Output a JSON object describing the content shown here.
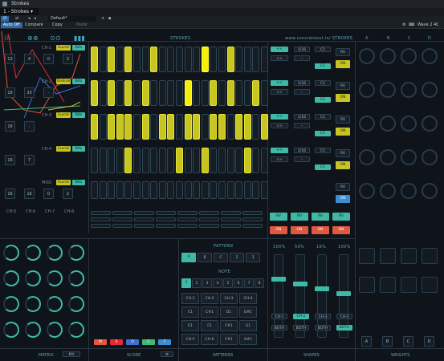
{
  "window": {
    "title": "Strokes"
  },
  "tab": {
    "label": "1 - Strokes"
  },
  "toolbar": {
    "preset": "Default*",
    "auto_off": "Auto Off",
    "compare": "Compare",
    "copy": "Copy",
    "paste": "Paste",
    "right_label": "Wave 2 4C",
    "power": "⏻"
  },
  "sections": {
    "strokes": "STROKES",
    "rate": "www.concreteout.in/ STROKES",
    "matrix": "MATRIX",
    "score": "SCORE",
    "patterns": "PATTERNS",
    "shapes": "SHAPES",
    "weights": "WEIGHTS"
  },
  "weights_cols": [
    "A",
    "B",
    "C",
    "D"
  ],
  "channels": [
    {
      "name": "CH-1",
      "mode": "Euclid",
      "alt": "Bits",
      "vals": [
        "13",
        "4",
        "0",
        "2"
      ],
      "steps": [
        1,
        0,
        1,
        0,
        1,
        0,
        0,
        1,
        0,
        0,
        0,
        0,
        0,
        1,
        0,
        0,
        1,
        0,
        0,
        0,
        0
      ],
      "rate": [
        "<<",
        "1/16",
        "C1",
        ">>",
        "··",
        "C1"
      ],
      "rv": "RV",
      "on": "ON"
    },
    {
      "name": "CH-2",
      "mode": "Ordinal",
      "alt": "Bits",
      "vals": [
        "16",
        "20",
        "·"
      ],
      "steps": [
        1,
        0,
        1,
        0,
        1,
        0,
        1,
        0,
        0,
        0,
        0,
        1,
        0,
        0,
        1,
        0,
        1,
        0,
        0,
        1,
        0
      ],
      "rate": [
        "<<",
        "1/16",
        "C1",
        ">>",
        "··",
        "C1"
      ],
      "rv": "RV",
      "on": "ON"
    },
    {
      "name": "CH-3",
      "mode": "Euclid",
      "alt": "Bits",
      "vals": [
        "16",
        "·"
      ],
      "steps": [
        1,
        0,
        1,
        1,
        1,
        0,
        1,
        0,
        1,
        1,
        0,
        1,
        1,
        0,
        1,
        1,
        0,
        1,
        1,
        0,
        1
      ],
      "rate": [
        "<<",
        "1/16",
        "C1",
        ">>",
        "··",
        "C1"
      ],
      "rv": "RV",
      "on": "ON"
    },
    {
      "name": "CH-4",
      "mode": "Euclid",
      "alt": "Bits",
      "vals": [
        "16",
        "7"
      ],
      "steps": [
        0,
        0,
        0,
        0,
        1,
        0,
        0,
        0,
        0,
        0,
        1,
        0,
        0,
        1,
        0,
        0,
        0,
        0,
        1,
        0,
        0
      ],
      "rate": [
        "<<",
        "1/16",
        "C1",
        ">>",
        "··",
        "C1"
      ],
      "rv": "RV",
      "on": "ON"
    },
    {
      "name": "MOD",
      "mode": "Euclid",
      "alt": "Bits",
      "vals": [
        "16",
        "16",
        "0",
        "2"
      ],
      "steps": [
        0,
        0,
        0,
        0,
        0,
        0,
        0,
        0,
        0,
        0,
        0,
        0,
        0,
        0,
        0,
        0,
        0,
        0,
        0,
        0,
        0
      ],
      "rate": [
        "BR",
        "VTU"
      ],
      "rv": "RV",
      "on": "ON"
    }
  ],
  "ch_row": [
    "CH-5",
    "CH-6",
    "CH-7",
    "CH-8"
  ],
  "rv_row": [
    "RV",
    "RV",
    "RV",
    "RV"
  ],
  "on_row": [
    "ON",
    "ON",
    "ON",
    "ON"
  ],
  "matrix_select": "MX",
  "score": {
    "colors": [
      "#e0583f",
      "#e02a3a",
      "#3a6fd4",
      "#3fb87a",
      "#3a8fd4"
    ],
    "labels": [
      "M",
      "S",
      "O",
      "C",
      "T"
    ]
  },
  "patterns": {
    "title": "PATTERN",
    "tabs": [
      "A",
      "B",
      "C",
      "2",
      "3"
    ],
    "note_title": "NOTE",
    "steps": [
      "1",
      "2",
      "3",
      "4",
      "5",
      "6",
      "7",
      "8"
    ],
    "cells": [
      "CH-1",
      "CH-2",
      "CH-3",
      "CH-4",
      "C1",
      "C#1",
      "D1",
      "D#1",
      "E1",
      "F1",
      "F#1",
      "G1",
      "CH-5",
      "CH-6",
      "F#1",
      "G#1"
    ]
  },
  "shapes": {
    "cols": [
      "100%",
      "50%",
      "16%",
      "100%"
    ],
    "labels": [
      "CH-1",
      "CH-2",
      "CH-3",
      "CH-4"
    ],
    "both": [
      "BOTH",
      "BOTH",
      "BOTH",
      "BOTH"
    ]
  },
  "weights": {
    "bottom": [
      "A",
      "B",
      "C",
      "D"
    ]
  }
}
